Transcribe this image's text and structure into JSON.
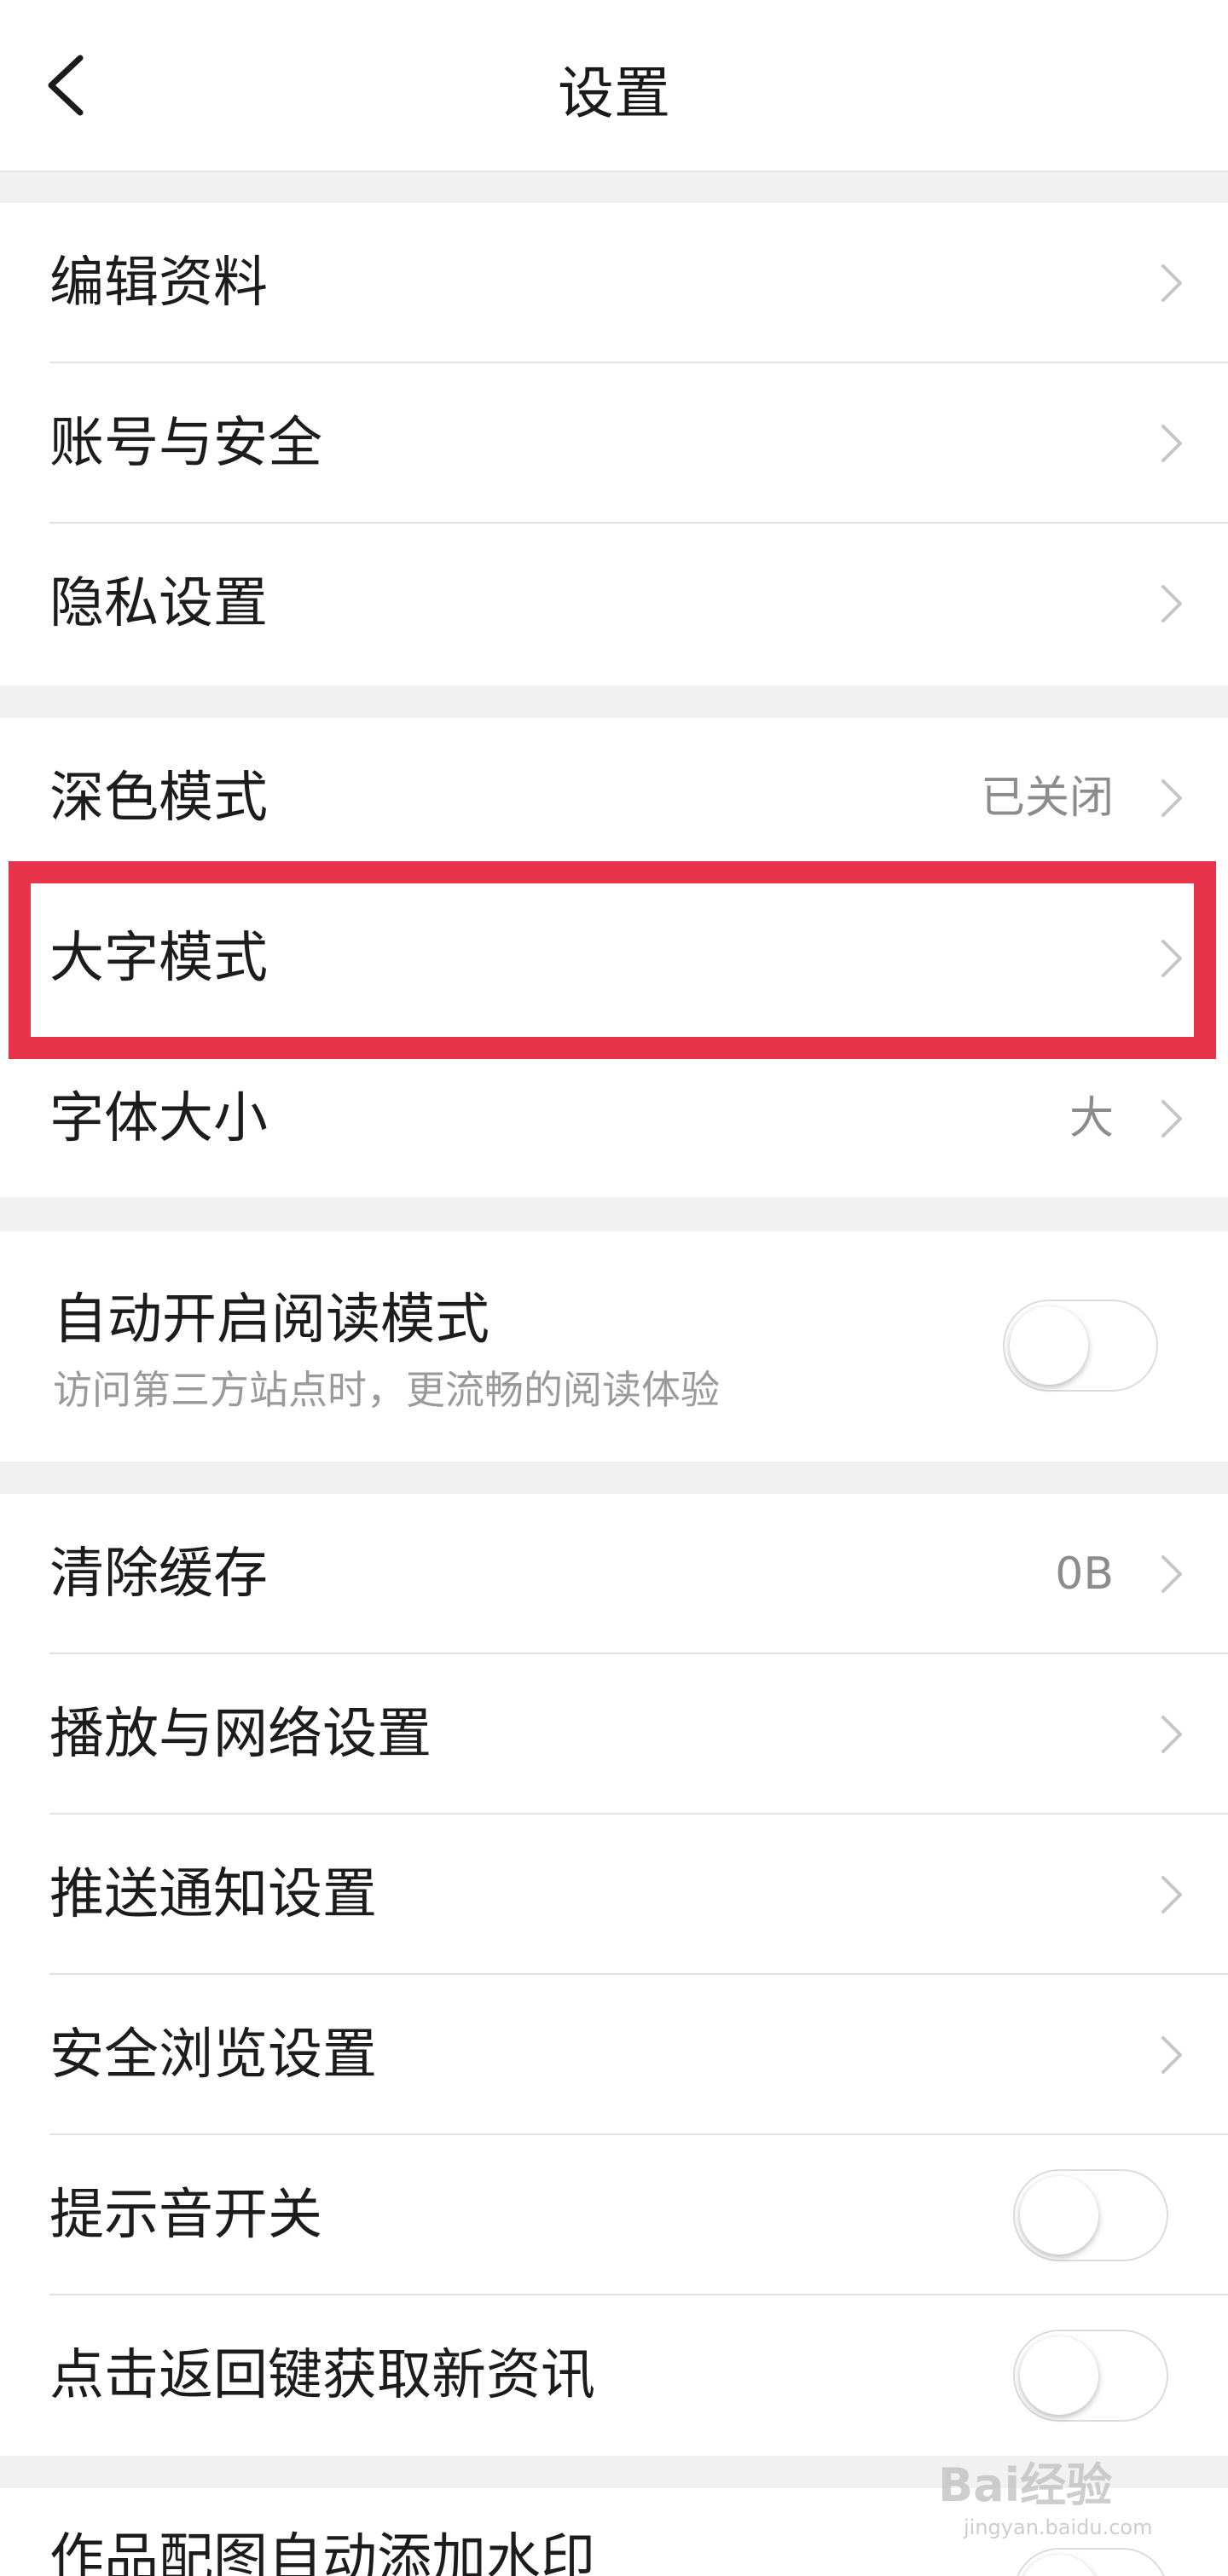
{
  "header": {
    "title": "设置"
  },
  "groups": [
    {
      "items": [
        {
          "label": "编辑资料",
          "value": ""
        },
        {
          "label": "账号与安全",
          "value": ""
        },
        {
          "label": "隐私设置",
          "value": ""
        }
      ]
    },
    {
      "items": [
        {
          "label": "深色模式",
          "value": "已关闭"
        },
        {
          "label": "大字模式",
          "value": ""
        },
        {
          "label": "字体大小",
          "value": "大"
        }
      ]
    },
    {
      "items": [
        {
          "label": "自动开启阅读模式",
          "sub_label": "访问第三方站点时，更流畅的阅读体验",
          "toggle_on": false
        }
      ]
    },
    {
      "items": [
        {
          "label": "清除缓存",
          "value": "0B"
        },
        {
          "label": "播放与网络设置",
          "value": ""
        },
        {
          "label": "推送通知设置",
          "value": ""
        },
        {
          "label": "安全浏览设置",
          "value": ""
        },
        {
          "label": "提示音开关",
          "toggle_on": false
        },
        {
          "label": "点击返回键获取新资讯",
          "toggle_on": false
        }
      ]
    },
    {
      "items": [
        {
          "label": "作品配图自动添加水印",
          "toggle_on": false
        }
      ]
    }
  ],
  "highlight": {
    "target": "大字模式",
    "color": "#e8344a"
  },
  "watermark": {
    "text": "Bai经验",
    "url": "jingyan.baidu.com"
  },
  "colors": {
    "background": "#f1f1f1",
    "card": "#ffffff",
    "secondary_text": "#8c8c8c"
  },
  "icons": {
    "back": "chevron-left-icon",
    "row_arrow": "chevron-right-icon"
  }
}
